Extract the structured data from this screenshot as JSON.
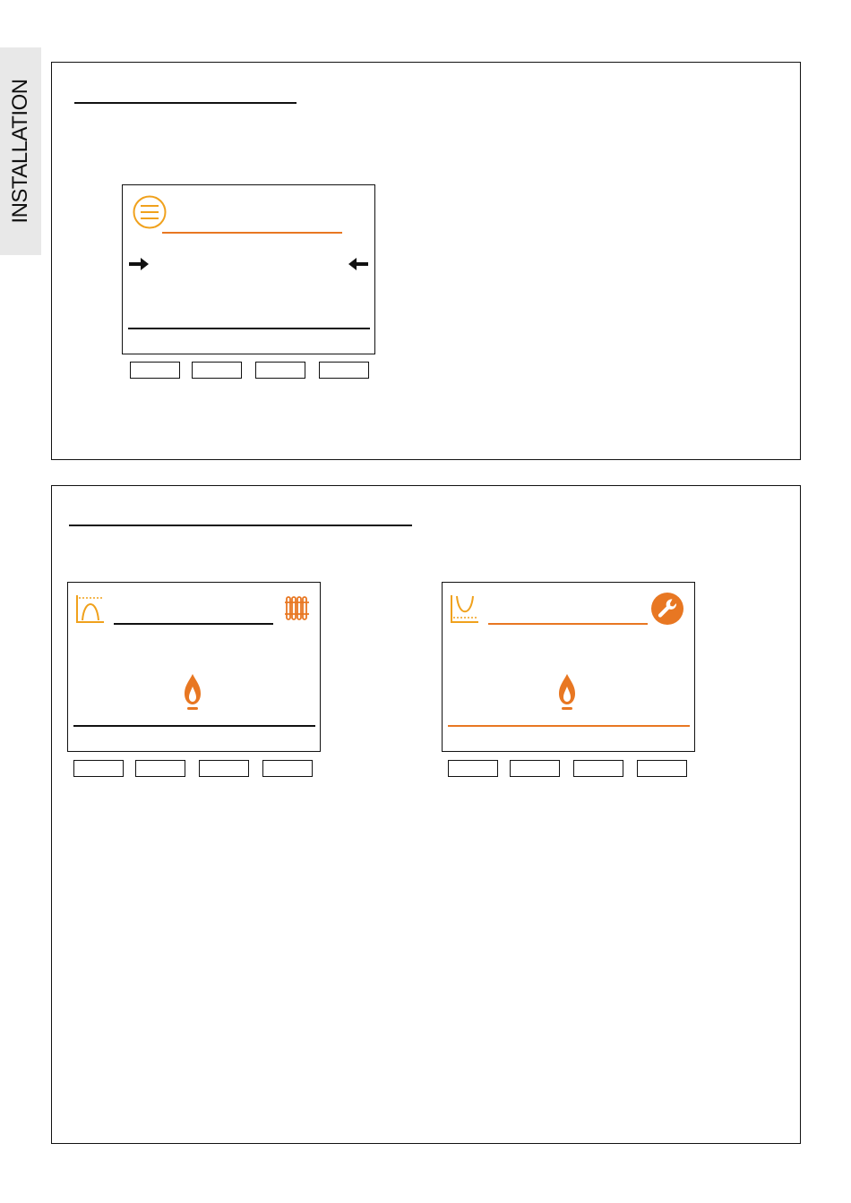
{
  "sidebar": {
    "label": "INSTALLATION"
  },
  "colors": {
    "orange": "#e87722",
    "amber": "#f0a11c",
    "black": "#111111"
  },
  "panel_1": {
    "screen": {
      "icons": [
        "menu-icon",
        "arrow-right-icon",
        "arrow-left-icon"
      ],
      "softkeys": 4
    }
  },
  "panel_2": {
    "screen_left": {
      "icons": [
        "heating-curve-icon",
        "radiator-icon",
        "flame-icon"
      ],
      "softkeys": 4
    },
    "screen_right": {
      "icons": [
        "dhw-curve-icon",
        "wrench-icon",
        "flame-icon"
      ],
      "softkeys": 4
    }
  }
}
